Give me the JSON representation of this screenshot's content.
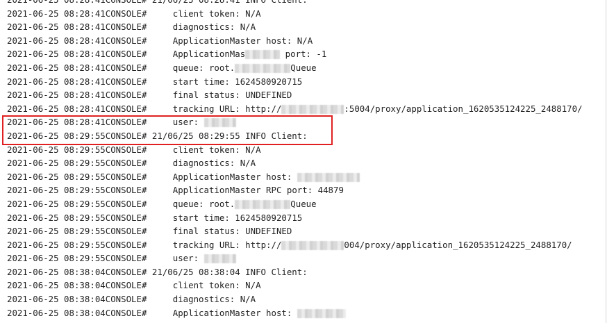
{
  "colors": {
    "text": "#222222",
    "background": "#ffffff",
    "highlight_border": "#e02020"
  },
  "log": {
    "lines": [
      {
        "ts": "2021-06-25 08:28:41",
        "src": "CONSOLE#",
        "msg": " 21/06/25 08:28:41 INFO Client:",
        "indent": false,
        "partial": true
      },
      {
        "ts": "2021-06-25 08:28:41",
        "src": "CONSOLE#",
        "msg": "client token: N/A",
        "indent": true
      },
      {
        "ts": "2021-06-25 08:28:41",
        "src": "CONSOLE#",
        "msg": "diagnostics: N/A",
        "indent": true
      },
      {
        "ts": "2021-06-25 08:28:41",
        "src": "CONSOLE#",
        "msg": "ApplicationMaster host: N/A",
        "indent": true
      },
      {
        "ts": "2021-06-25 08:28:41",
        "src": "CONSOLE#",
        "msg": "ApplicationMas",
        "redact": 50,
        "after": " port: -1",
        "indent": true
      },
      {
        "ts": "2021-06-25 08:28:41",
        "src": "CONSOLE#",
        "msg": "queue: root.",
        "redact": 80,
        "after": "Queue",
        "indent": true
      },
      {
        "ts": "2021-06-25 08:28:41",
        "src": "CONSOLE#",
        "msg": "start time: 1624580920715",
        "indent": true
      },
      {
        "ts": "2021-06-25 08:28:41",
        "src": "CONSOLE#",
        "msg": "final status: UNDEFINED",
        "indent": true
      },
      {
        "ts": "2021-06-25 08:28:41",
        "src": "CONSOLE#",
        "msg": "tracking URL: http://",
        "redact": 90,
        "after": ":5004/proxy/application_1620535124225_2488170/",
        "indent": true
      },
      {
        "ts": "2021-06-25 08:28:41",
        "src": "CONSOLE#",
        "msg": "user: ",
        "redact": 46,
        "after": "",
        "indent": true
      },
      {
        "ts": "2021-06-25 08:29:55",
        "src": "CONSOLE#",
        "msg": " 21/06/25 08:29:55 INFO Client:",
        "indent": false
      },
      {
        "ts": "2021-06-25 08:29:55",
        "src": "CONSOLE#",
        "msg": "client token: N/A",
        "indent": true
      },
      {
        "ts": "2021-06-25 08:29:55",
        "src": "CONSOLE#",
        "msg": "diagnostics: N/A",
        "indent": true
      },
      {
        "ts": "2021-06-25 08:29:55",
        "src": "CONSOLE#",
        "msg": "ApplicationMaster host: ",
        "redact": 90,
        "after": "",
        "indent": true
      },
      {
        "ts": "2021-06-25 08:29:55",
        "src": "CONSOLE#",
        "msg": "ApplicationMaster RPC port: 44879",
        "indent": true
      },
      {
        "ts": "2021-06-25 08:29:55",
        "src": "CONSOLE#",
        "msg": "queue: root.",
        "redact": 80,
        "after": "Queue",
        "indent": true
      },
      {
        "ts": "2021-06-25 08:29:55",
        "src": "CONSOLE#",
        "msg": "start time: 1624580920715",
        "indent": true
      },
      {
        "ts": "2021-06-25 08:29:55",
        "src": "CONSOLE#",
        "msg": "final status: UNDEFINED",
        "indent": true
      },
      {
        "ts": "2021-06-25 08:29:55",
        "src": "CONSOLE#",
        "msg": "tracking URL: http://",
        "redact": 90,
        "after": "004/proxy/application_1620535124225_2488170/",
        "indent": true
      },
      {
        "ts": "2021-06-25 08:29:55",
        "src": "CONSOLE#",
        "msg": "user: ",
        "redact": 46,
        "after": "",
        "indent": true
      },
      {
        "ts": "2021-06-25 08:38:04",
        "src": "CONSOLE#",
        "msg": " 21/06/25 08:38:04 INFO Client:",
        "indent": false
      },
      {
        "ts": "2021-06-25 08:38:04",
        "src": "CONSOLE#",
        "msg": "client token: N/A",
        "indent": true
      },
      {
        "ts": "2021-06-25 08:38:04",
        "src": "CONSOLE#",
        "msg": "diagnostics: N/A",
        "indent": true
      },
      {
        "ts": "2021-06-25 08:38:04",
        "src": "CONSOLE#",
        "msg": "ApplicationMaster host: ",
        "redact": 70,
        "after": "",
        "indent": true
      }
    ]
  }
}
